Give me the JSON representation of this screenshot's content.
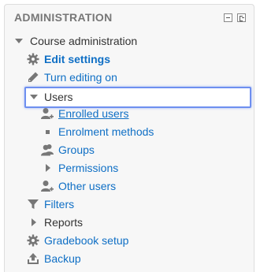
{
  "block": {
    "title": "ADMINISTRATION",
    "hide_icon": "hide-block-icon",
    "dock_icon": "dock-block-icon"
  },
  "tree": {
    "course_administration": "Course administration",
    "edit_settings": "Edit settings",
    "turn_editing_on": "Turn editing on",
    "users": "Users",
    "enrolled_users": "Enrolled users",
    "enrolment_methods": "Enrolment methods",
    "groups": "Groups",
    "permissions": "Permissions",
    "other_users": "Other users",
    "filters": "Filters",
    "reports": "Reports",
    "gradebook_setup": "Gradebook setup",
    "backup": "Backup"
  },
  "colors": {
    "link": "#0f6fc5",
    "text": "#333333",
    "icon": "#777777",
    "focus": "#6e8ff0"
  }
}
